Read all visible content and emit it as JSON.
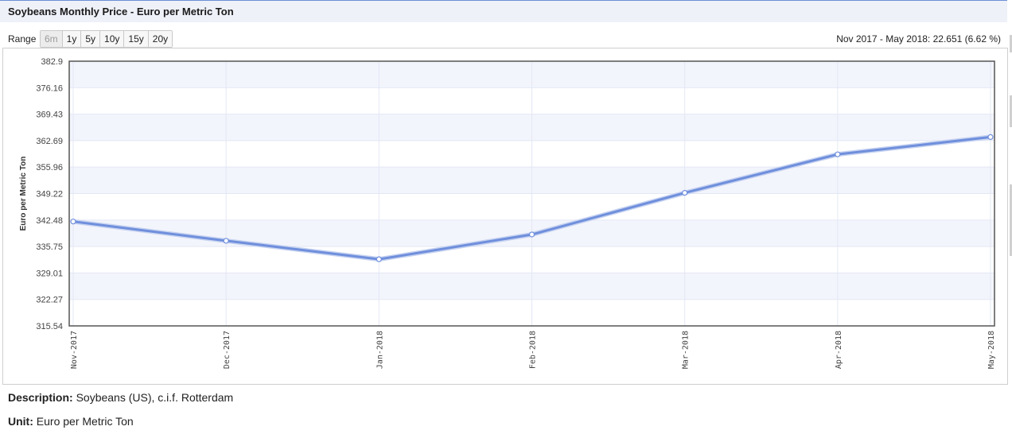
{
  "header": {
    "title": "Soybeans Monthly Price - Euro per Metric Ton"
  },
  "range": {
    "label": "Range",
    "buttons": [
      "6m",
      "1y",
      "5y",
      "10y",
      "15y",
      "20y"
    ],
    "disabled": "6m"
  },
  "change_text": "Nov 2017 - May 2018: 22.651 (6.62 %)",
  "footer": {
    "description_label": "Description:",
    "description_value": "Soybeans (US), c.i.f. Rotterdam",
    "unit_label": "Unit:",
    "unit_value": "Euro per Metric Ton"
  },
  "chart_data": {
    "type": "line",
    "title": "",
    "xlabel": "",
    "ylabel": "Euro per Metric Ton",
    "categories": [
      "Nov-2017",
      "Dec-2017",
      "Jan-2018",
      "Feb-2018",
      "Mar-2018",
      "Apr-2018",
      "May-2018"
    ],
    "y_ticks": [
      "382.9",
      "376.16",
      "369.43",
      "362.69",
      "355.96",
      "349.22",
      "342.48",
      "335.75",
      "329.01",
      "322.27",
      "315.54"
    ],
    "ylim": [
      315.54,
      382.9
    ],
    "series": [
      {
        "values": [
          342.1,
          337.2,
          332.5,
          338.8,
          349.4,
          359.2,
          363.6
        ]
      }
    ],
    "grid": true,
    "line_color": "#6f8fdc",
    "band_color": "#f3f5fc"
  }
}
